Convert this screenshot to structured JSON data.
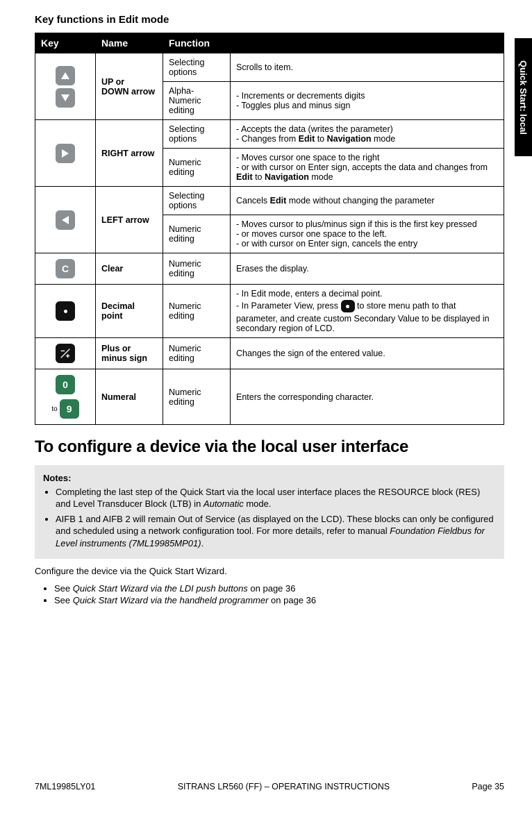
{
  "side_tab": "Quick Start: local",
  "section_title": "Key functions in Edit mode",
  "table": {
    "headers": {
      "key": "Key",
      "name": "Name",
      "function": "Function"
    },
    "rows": {
      "updown": {
        "name_prefix": "UP",
        "name_mid": " or ",
        "name_down": "DOWN arrow",
        "r1_func": "Selecting options",
        "r1_desc": "Scrolls to item.",
        "r2_func": "Alpha-Numeric editing",
        "r2_desc": "- Increments or decrements digits\n- Toggles plus and minus sign"
      },
      "right": {
        "name": "RIGHT arrow",
        "r1_func": "Selecting options",
        "r1_desc_l1": "- Accepts the data (writes the parameter)",
        "r1_desc_l2a": "- Changes from ",
        "r1_desc_l2b": "Edit",
        "r1_desc_l2c": " to ",
        "r1_desc_l2d": "Navigation",
        "r1_desc_l2e": " mode",
        "r2_func": "Numeric editing",
        "r2_desc_l1": "- Moves cursor one space to the right",
        "r2_desc_l2a": "- or with cursor on Enter sign, accepts the data and changes from ",
        "r2_desc_l2b": "Edit",
        "r2_desc_l2c": " to ",
        "r2_desc_l2d": "Navigation",
        "r2_desc_l2e": " mode"
      },
      "left": {
        "name": "LEFT arrow",
        "r1_func": "Selecting options",
        "r1_desc_a": "Cancels ",
        "r1_desc_b": "Edit",
        "r1_desc_c": " mode without changing the parameter",
        "r2_func": "Numeric editing",
        "r2_desc": "- Moves cursor to plus/minus sign if this is the first key pressed\n- or moves cursor one space to the left.\n- or with cursor on Enter sign, cancels the entry"
      },
      "clear": {
        "name": "Clear",
        "func": "Numeric editing",
        "desc": " Erases the display."
      },
      "decimal": {
        "name": "Decimal point",
        "func": "Numeric editing",
        "desc_l1": "- In Edit mode, enters a decimal point.",
        "desc_l2a": "- In Parameter View, press ",
        "desc_l2b": " to store menu path to that parameter, and create custom Secondary Value to be displayed in secondary region of LCD."
      },
      "pm": {
        "name": "Plus or minus sign",
        "func": "Numeric editing",
        "desc": "Changes the sign of the entered value."
      },
      "numeral": {
        "to": "to",
        "name": "Numeral",
        "func": "Numeric editing",
        "desc": "Enters the corresponding character."
      }
    }
  },
  "big_heading": "To configure a device via the local user interface",
  "notes": {
    "label": "Notes:",
    "items": {
      "n1a": "Completing the last step of the Quick Start via the local user interface places the RESOURCE block (RES) and Level Transducer Block (LTB) in ",
      "n1b": "Automatic",
      "n1c": " mode.",
      "n2a": "AIFB 1 and AIFB 2 will remain Out of Service (as displayed on the LCD). These blocks can only be configured and scheduled using a network configuration tool. For more details, refer to manual ",
      "n2b": "Foundation Fieldbus for Level instruments (7ML19985MP01)",
      "n2c": "."
    }
  },
  "body_text": "Configure the device via the Quick Start Wizard.",
  "see_list": {
    "s1a": "See ",
    "s1b": "Quick Start Wizard via the LDI push buttons ",
    "s1c": " on page 36",
    "s2a": "See ",
    "s2b": "Quick Start Wizard via the handheld programmer ",
    "s2c": " on page 36"
  },
  "footer": {
    "left": "7ML19985LY01",
    "center": "SITRANS LR560 (FF) – OPERATING INSTRUCTIONS",
    "right": "Page 35"
  }
}
